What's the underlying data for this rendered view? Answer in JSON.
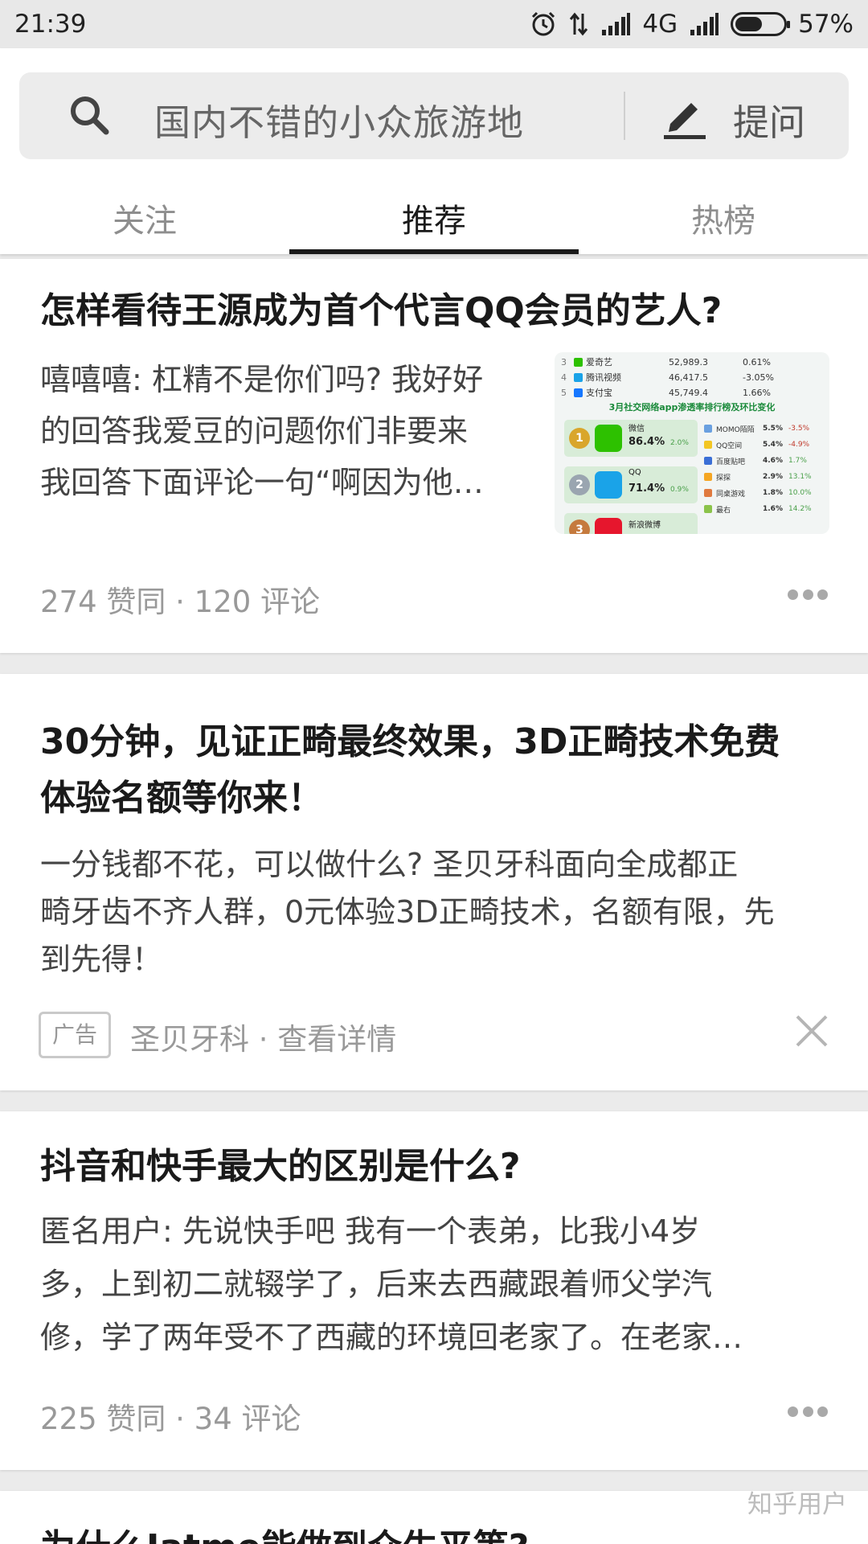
{
  "status": {
    "time": "21:39",
    "network": "4G",
    "battery_text": "57%",
    "battery_level": 0.57
  },
  "search": {
    "placeholder": "国内不错的小众旅游地",
    "ask_label": "提问"
  },
  "tabs": [
    {
      "label": "关注",
      "active": false
    },
    {
      "label": "推荐",
      "active": true
    },
    {
      "label": "热榜",
      "active": false
    }
  ],
  "feed": [
    {
      "type": "answer",
      "title": "怎样看待王源成为首个代言QQ会员的艺人?",
      "excerpt_lines": [
        "嘻嘻嘻: 杠精不是你们吗? 我好好",
        "的回答我爱豆的问题你们非要来",
        "我回答下面评论一句“啊因为他…"
      ],
      "meta": "274 赞同 · 120 评论",
      "thumbnail": {
        "rows": [
          {
            "rank": "3",
            "name": "爱奇艺",
            "value": "52,989.3",
            "pct": "0.61%"
          },
          {
            "rank": "4",
            "name": "腾讯视频",
            "value": "46,417.5",
            "pct": "-3.05%"
          },
          {
            "rank": "5",
            "name": "支付宝",
            "value": "45,749.4",
            "pct": "1.66%"
          }
        ],
        "title": "3月社交网络app渗透率排行榜及环比变化",
        "left": [
          {
            "rank": "1",
            "name": "微信",
            "pct": "86.4%",
            "delta": "2.0%"
          },
          {
            "rank": "2",
            "name": "QQ",
            "pct": "71.4%",
            "delta": "0.9%"
          },
          {
            "rank": "3",
            "name": "新浪微博"
          }
        ],
        "right": [
          {
            "name": "MOMO陌陌",
            "pct": "5.5%",
            "delta": "-3.5%"
          },
          {
            "name": "QQ空间",
            "pct": "5.4%",
            "delta": "-4.9%"
          },
          {
            "name": "百度贴吧",
            "pct": "4.6%",
            "delta": "1.7%"
          },
          {
            "name": "探探",
            "pct": "2.9%",
            "delta": "13.1%"
          },
          {
            "name": "同桌游戏",
            "pct": "1.8%",
            "delta": "10.0%"
          },
          {
            "name": "最右",
            "pct": "1.6%",
            "delta": "14.2%"
          }
        ],
        "colors": {
          "wechat": "#2dc100",
          "qq": "#1aa3e8",
          "weibo": "#e6162d",
          "accent": "#1a8a3a"
        }
      }
    },
    {
      "type": "ad",
      "title_lines": [
        "30分钟，见证正畸最终效果，3D正畸技术免费",
        "体验名额等你来！"
      ],
      "excerpt_lines": [
        "一分钱都不花，可以做什么? 圣贝牙科面向全成都正",
        "畸牙齿不齐人群，0元体验3D正畸技术，名额有限，先",
        "到先得！"
      ],
      "ad_label": "广告",
      "meta": "圣贝牙科 · 查看详情"
    },
    {
      "type": "answer",
      "title": "抖音和快手最大的区别是什么?",
      "excerpt_lines": [
        "匿名用户: 先说快手吧 我有一个表弟，比我小4岁",
        "多，上到初二就辍学了，后来去西藏跟着师父学汽",
        "修，学了两年受不了西藏的环境回老家了。在老家…"
      ],
      "meta": "225 赞同 · 34 评论"
    },
    {
      "type": "answer",
      "title": "为什么Iatme能做到众生平等?"
    }
  ],
  "watermark": "知乎用户"
}
